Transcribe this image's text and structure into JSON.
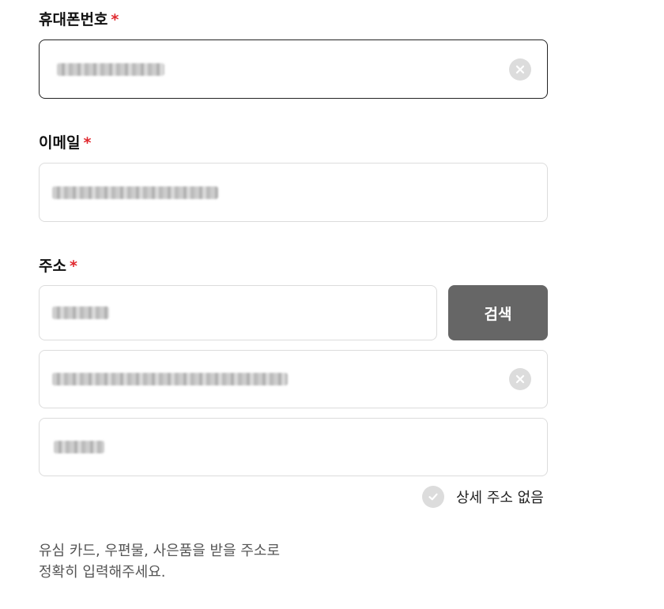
{
  "form": {
    "required_mark": "*",
    "phone": {
      "label": "휴대폰번호",
      "value": "",
      "masked": true,
      "clear_icon": "clear-icon"
    },
    "email": {
      "label": "이메일",
      "value": "",
      "masked": true
    },
    "address": {
      "label": "주소",
      "zipcode_value": "",
      "search_button": "검색",
      "road_address_value": "",
      "detail_value": "",
      "no_detail_label": "상세 주소 없음",
      "no_detail_icon": "check-icon"
    },
    "notice_line1": "유심 카드, 우편물, 사은품을 받을 주소로",
    "notice_line2": "정확히 입력해주세요."
  },
  "colors": {
    "required": "#e0282e",
    "button_bg": "#666666",
    "border": "#dcdcdc",
    "active_border": "#222222"
  }
}
